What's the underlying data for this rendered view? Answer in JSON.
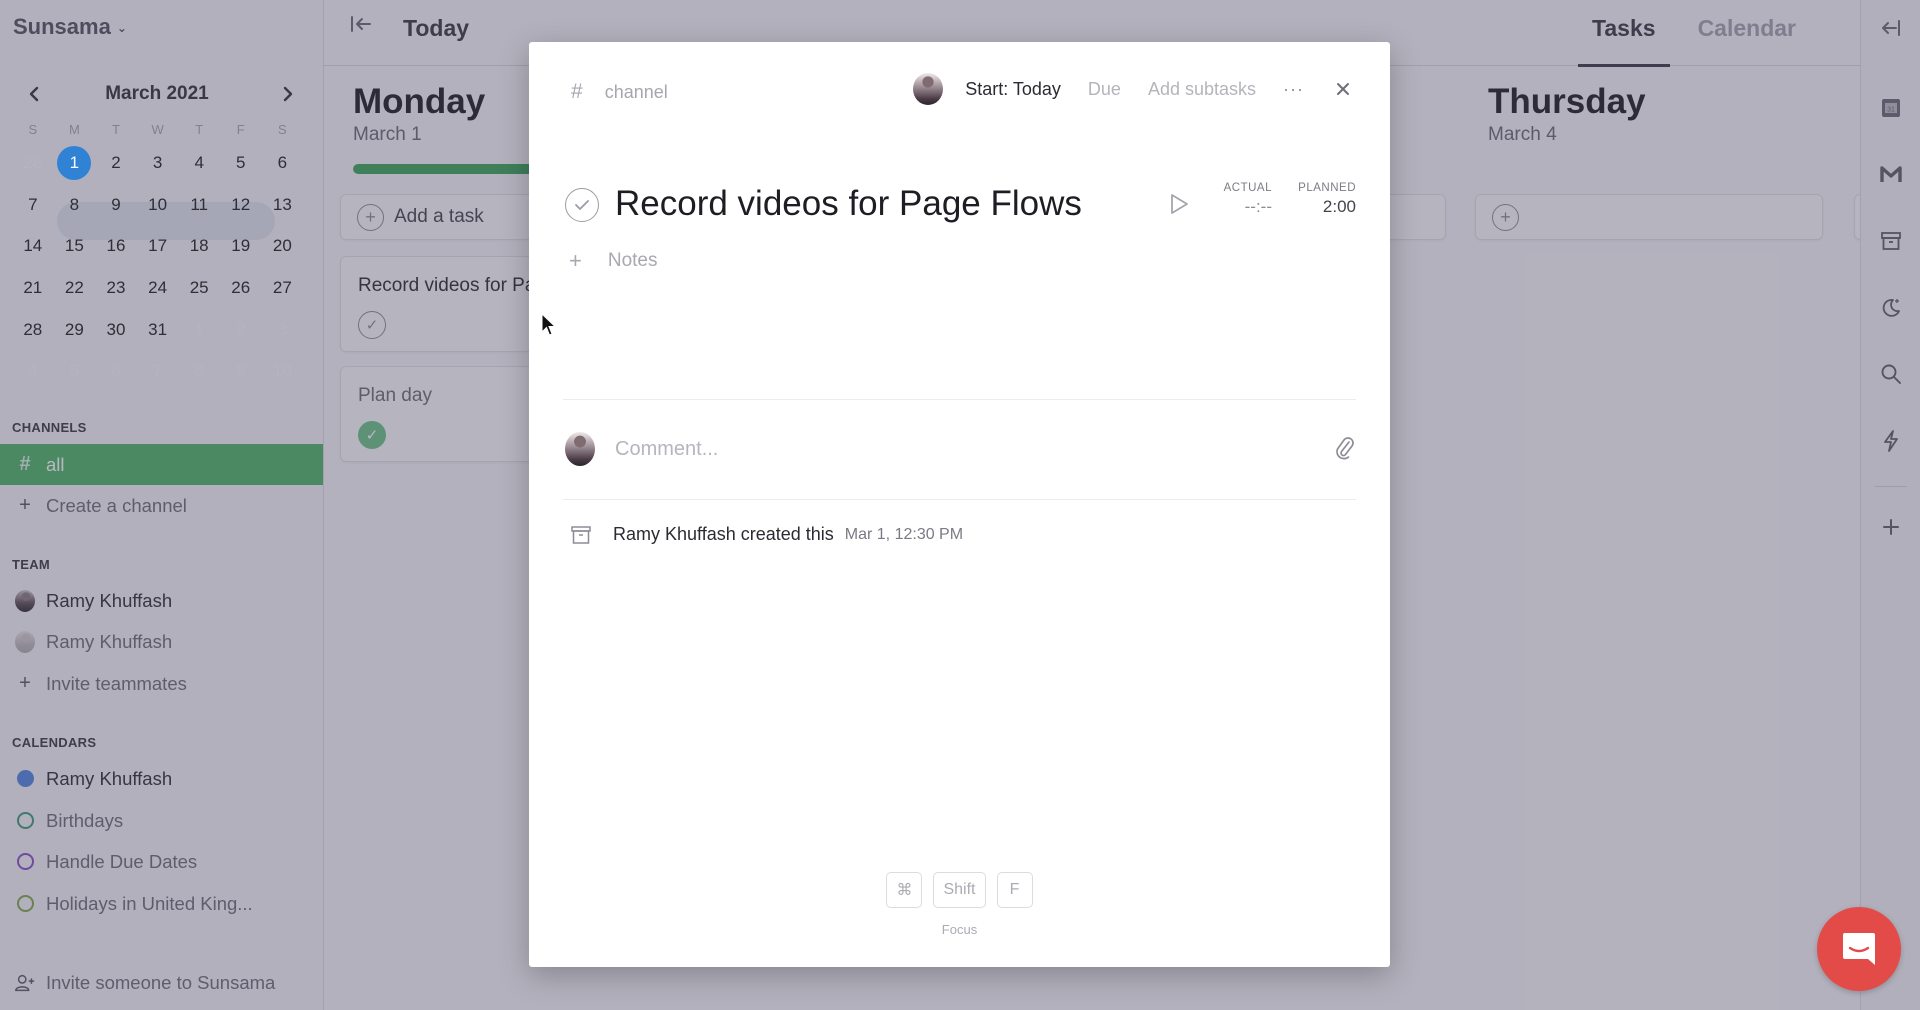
{
  "sidebar": {
    "brand": "Sunsama",
    "calendar": {
      "month_label": "March 2021",
      "prev_label": "‹",
      "next_label": "›",
      "weekdays": [
        "S",
        "M",
        "T",
        "W",
        "T",
        "F",
        "S"
      ],
      "weeks": [
        [
          {
            "d": "28",
            "muted": true
          },
          {
            "d": "1",
            "today": true
          },
          {
            "d": "2"
          },
          {
            "d": "3"
          },
          {
            "d": "4"
          },
          {
            "d": "5"
          },
          {
            "d": "6"
          }
        ],
        [
          {
            "d": "7"
          },
          {
            "d": "8"
          },
          {
            "d": "9"
          },
          {
            "d": "10"
          },
          {
            "d": "11"
          },
          {
            "d": "12"
          },
          {
            "d": "13"
          }
        ],
        [
          {
            "d": "14"
          },
          {
            "d": "15"
          },
          {
            "d": "16"
          },
          {
            "d": "17"
          },
          {
            "d": "18"
          },
          {
            "d": "19"
          },
          {
            "d": "20"
          }
        ],
        [
          {
            "d": "21"
          },
          {
            "d": "22"
          },
          {
            "d": "23"
          },
          {
            "d": "24"
          },
          {
            "d": "25"
          },
          {
            "d": "26"
          },
          {
            "d": "27"
          }
        ],
        [
          {
            "d": "28"
          },
          {
            "d": "29"
          },
          {
            "d": "30"
          },
          {
            "d": "31"
          },
          {
            "d": "1",
            "muted": true
          },
          {
            "d": "2",
            "muted": true
          },
          {
            "d": "3",
            "muted": true
          }
        ],
        [
          {
            "d": "4",
            "muted": true
          },
          {
            "d": "5",
            "muted": true
          },
          {
            "d": "6",
            "muted": true
          },
          {
            "d": "7",
            "muted": true
          },
          {
            "d": "8",
            "muted": true
          },
          {
            "d": "9",
            "muted": true
          },
          {
            "d": "10",
            "muted": true
          }
        ]
      ]
    },
    "channels": {
      "label": "CHANNELS",
      "items": [
        {
          "label": "all",
          "icon": "#",
          "active": true
        }
      ],
      "create_label": "Create a channel"
    },
    "team": {
      "label": "TEAM",
      "members": [
        {
          "name": "Ramy Khuffash"
        },
        {
          "name": "Ramy Khuffash"
        }
      ],
      "invite_label": "Invite teammates"
    },
    "calendars": {
      "label": "CALENDARS",
      "items": [
        {
          "label": "Ramy Khuffash",
          "color": "#4f86e0",
          "filled": true
        },
        {
          "label": "Birthdays",
          "color": "#3f9b78",
          "filled": false
        },
        {
          "label": "Handle Due Dates",
          "color": "#8a4fc7",
          "filled": false
        },
        {
          "label": "Holidays in United King...",
          "color": "#7faa4a",
          "filled": false
        }
      ]
    },
    "invite_someone_label": "Invite someone to Sunsama"
  },
  "header": {
    "title": "Today",
    "tabs": [
      {
        "label": "Tasks",
        "active": true
      },
      {
        "label": "Calendar",
        "active": false
      }
    ]
  },
  "days": [
    {
      "name": "Monday",
      "date": "March 1",
      "progress": 0.9,
      "add_task_label": "Add a task",
      "tasks": [
        {
          "title": "Record videos for Page Flows",
          "done": false
        },
        {
          "title": "Plan day",
          "done": true
        }
      ]
    },
    {
      "name": "Thursday",
      "date": "March 4"
    }
  ],
  "right_rail": {
    "icons": [
      "google-calendar-icon",
      "gmail-icon",
      "archive-icon",
      "moon-icon",
      "search-icon",
      "lightning-icon",
      "plus-icon"
    ]
  },
  "modal": {
    "channel_placeholder": "channel",
    "start_label": "Start: Today",
    "due_label": "Due",
    "add_subtasks_label": "Add subtasks",
    "more_label": "···",
    "close_label": "✕",
    "task_title": "Record videos for Page Flows",
    "actual_label": "ACTUAL",
    "actual_value": "--:--",
    "planned_label": "PLANNED",
    "planned_value": "2:00",
    "notes_placeholder": "Notes",
    "comment_placeholder": "Comment...",
    "activity": {
      "text": "Ramy Khuffash created this",
      "time": "Mar 1, 12:30 PM"
    },
    "shortcut_keys": [
      "⌘",
      "Shift",
      "F"
    ],
    "shortcut_label": "Focus"
  },
  "colors": {
    "accent_green": "#4cb566",
    "today_blue": "#2f82d4",
    "chat_red": "#e34b48"
  }
}
